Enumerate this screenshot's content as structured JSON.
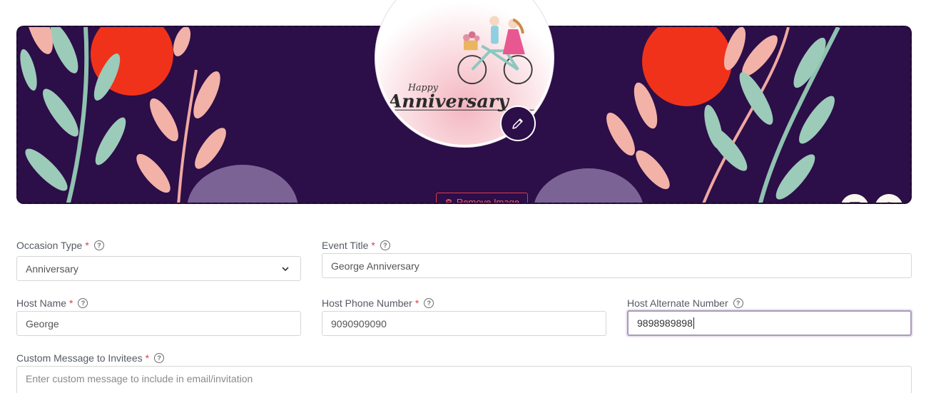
{
  "banner": {
    "remove_image_label": "Remove Image",
    "avatar_caption_small": "Happy",
    "avatar_caption_large": "Anniversary",
    "colors": {
      "background": "#2c0e48",
      "accent_red": "#e53946"
    }
  },
  "form": {
    "occasion_type": {
      "label": "Occasion Type",
      "required": "*",
      "value": "Anniversary"
    },
    "event_title": {
      "label": "Event Title",
      "required": "*",
      "value": "George Anniversary"
    },
    "host_name": {
      "label": "Host Name",
      "required": "*",
      "value": "George"
    },
    "host_phone": {
      "label": "Host Phone Number",
      "required": "*",
      "value": "9090909090"
    },
    "host_alternate": {
      "label": "Host Alternate Number",
      "value": "9898989898"
    },
    "custom_message": {
      "label": "Custom Message to Invitees",
      "required": "*",
      "placeholder": "Enter custom message to include in email/invitation"
    }
  },
  "icons": [
    "pencil-icon",
    "trash-icon",
    "image-icon",
    "palette-icon",
    "help-icon",
    "chevron-down-icon"
  ]
}
